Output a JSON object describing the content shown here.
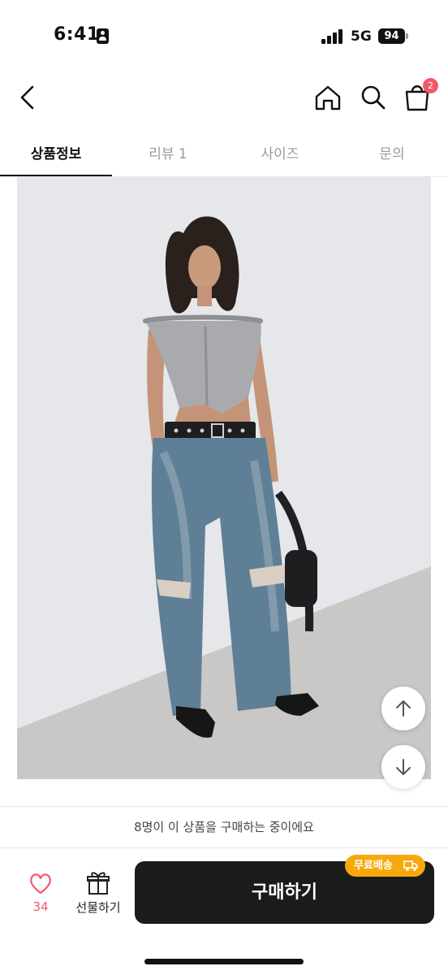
{
  "status_bar": {
    "time": "6:41",
    "network": "5G",
    "battery": "94"
  },
  "nav": {
    "cart_count": "2",
    "icons": [
      "chevron-left-icon",
      "home-icon",
      "search-icon",
      "shopping-bag-icon"
    ]
  },
  "tabs": [
    {
      "label": "상품정보",
      "active": true
    },
    {
      "label": "리뷰 1",
      "active": false
    },
    {
      "label": "사이즈",
      "active": false
    },
    {
      "label": "문의",
      "active": false
    }
  ],
  "notice": "8명이 이 상품을 구매하는 중이에요",
  "bottom_bar": {
    "like_count": "34",
    "gift_label": "선물하기",
    "buy_label": "구매하기",
    "free_shipping_label": "무료배송"
  },
  "colors": {
    "accent_pink": "#f2596a",
    "badge_orange": "#f7a90c",
    "buy_button": "#1b1b1b"
  }
}
